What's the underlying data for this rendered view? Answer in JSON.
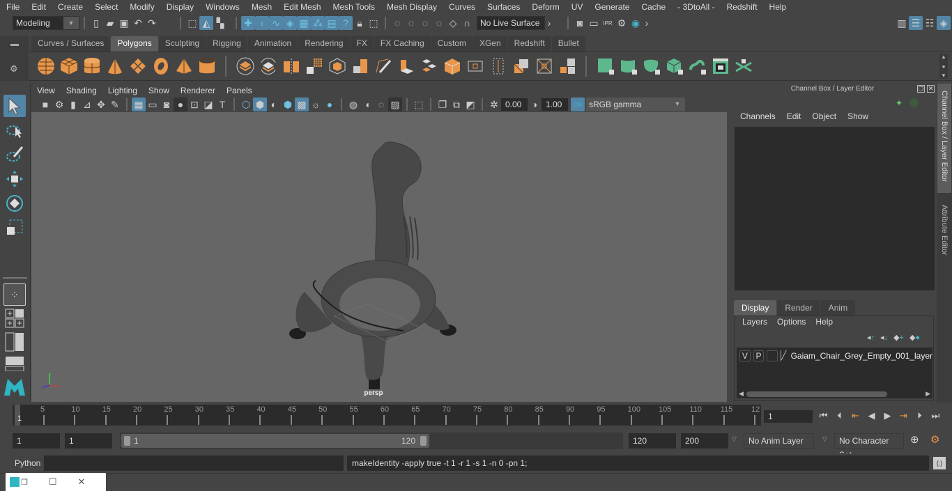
{
  "menubar": {
    "items": [
      "File",
      "Edit",
      "Create",
      "Select",
      "Modify",
      "Display",
      "Windows",
      "Mesh",
      "Edit Mesh",
      "Mesh Tools",
      "Mesh Display",
      "Curves",
      "Surfaces",
      "Deform",
      "UV",
      "Generate",
      "Cache",
      "- 3DtoAll -",
      "Redshift",
      "Help"
    ]
  },
  "statusline": {
    "mode": "Modeling",
    "live_surface": "No Live Surface"
  },
  "shelf": {
    "tabs": [
      "Curves / Surfaces",
      "Polygons",
      "Sculpting",
      "Rigging",
      "Animation",
      "Rendering",
      "FX",
      "FX Caching",
      "Custom",
      "XGen",
      "Redshift",
      "Bullet"
    ],
    "active_tab": "Polygons",
    "accent_orange": "#e8964a",
    "accent_green": "#5db88e"
  },
  "viewport": {
    "menu": [
      "View",
      "Shading",
      "Lighting",
      "Show",
      "Renderer",
      "Panels"
    ],
    "exposure": "0.00",
    "gamma": "1.00",
    "color_space": "sRGB gamma",
    "camera_label": "persp",
    "axis": {
      "x": "x",
      "y": "y",
      "z": "z"
    }
  },
  "channel_box": {
    "title": "Channel Box / Layer Editor",
    "menu": [
      "Channels",
      "Edit",
      "Object",
      "Show"
    ]
  },
  "layer_editor": {
    "tabs": [
      "Display",
      "Render",
      "Anim"
    ],
    "active_tab": "Display",
    "menu": [
      "Layers",
      "Options",
      "Help"
    ],
    "layers": [
      {
        "v": "V",
        "p": "P",
        "name": "Gaiam_Chair_Grey_Empty_001_layer"
      }
    ]
  },
  "side_tabs": [
    "Channel Box / Layer Editor",
    "Attribute Editor"
  ],
  "timeline": {
    "ticks": [
      "5",
      "10",
      "15",
      "20",
      "25",
      "30",
      "35",
      "40",
      "45",
      "50",
      "55",
      "60",
      "65",
      "70",
      "75",
      "80",
      "85",
      "90",
      "95",
      "100",
      "105",
      "110",
      "115",
      "12"
    ],
    "current_frame_marker": "1",
    "current_frame": "1"
  },
  "range": {
    "start": "1",
    "playback_start": "1",
    "slider_start": "1",
    "slider_end": "120",
    "playback_end": "120",
    "end": "200",
    "anim_layer": "No Anim Layer",
    "character_set": "No Character Set"
  },
  "command_line": {
    "language": "Python",
    "input": "",
    "result": "makeIdentity -apply true -t 1 -r 1 -s 1 -n 0 -pn 1;"
  }
}
